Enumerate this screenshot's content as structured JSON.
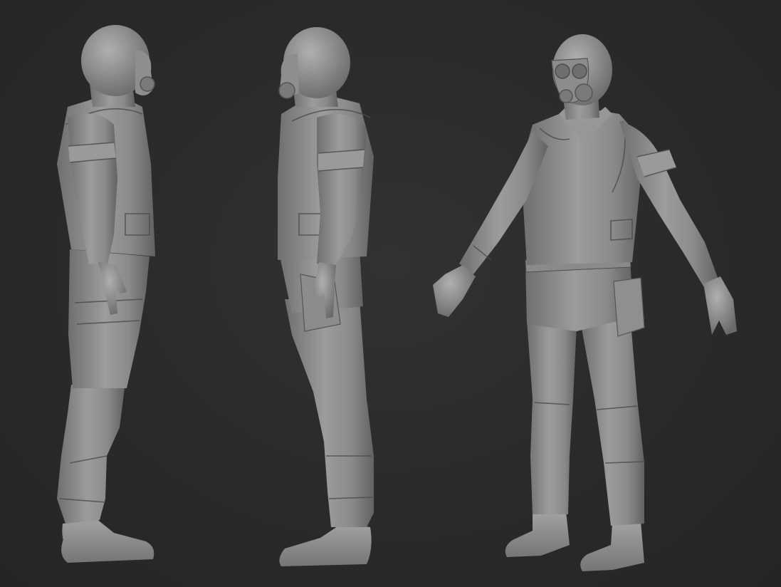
{
  "scene": {
    "background_color": "#2b2b2b",
    "material_color": "#8c8c8c",
    "views": [
      "left-side",
      "right-side",
      "three-quarter-front"
    ]
  }
}
